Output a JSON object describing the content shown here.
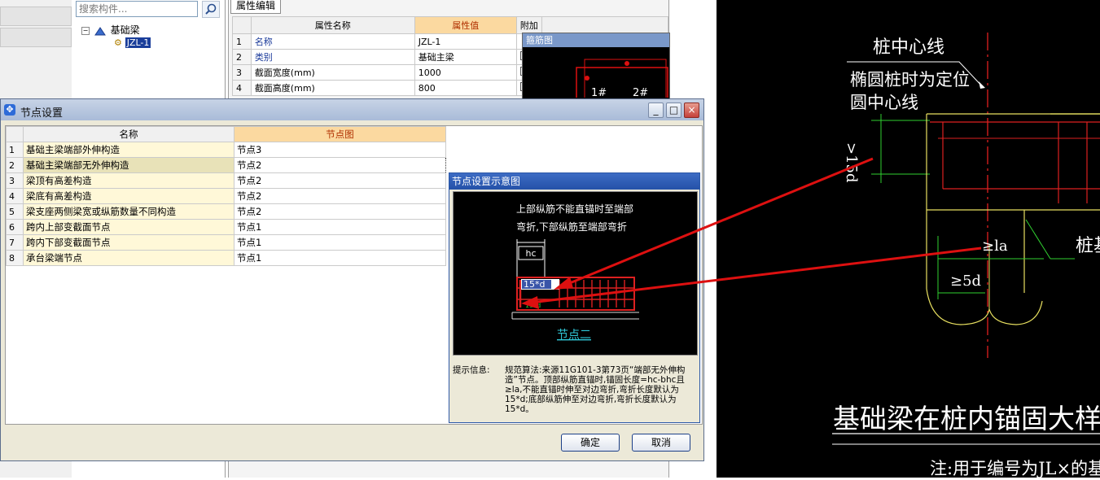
{
  "colors": {
    "accent_red": "#dd1010",
    "cad_bg": "#000000",
    "header_highlight": "#fbd9a0"
  },
  "left_tree": {
    "search_placeholder": "搜索构件...",
    "root_label": "基础梁",
    "child_label": "JZL-1"
  },
  "property_panel": {
    "tab": "属性编辑",
    "headers": {
      "name": "属性名称",
      "value": "属性值",
      "extra": "附加"
    },
    "rows": [
      {
        "idx": "1",
        "name": "名称",
        "value": "JZL-1"
      },
      {
        "idx": "2",
        "name": "类别",
        "value": "基础主梁"
      },
      {
        "idx": "3",
        "name": "截面宽度(mm)",
        "value": "1000"
      },
      {
        "idx": "4",
        "name": "截面高度(mm)",
        "value": "800"
      }
    ],
    "mini_preview_title": "箍筋图",
    "mini_labels": [
      "1#",
      "2#"
    ]
  },
  "cad_drawing": {
    "label_pile_center": "桩中心线",
    "label_ellipse_1": "椭圆桩时为定位",
    "label_ellipse_2": "圆中心线",
    "label_15d": ">15d",
    "label_la": "≥la",
    "label_5d": "≥5d",
    "label_pile_base": "桩基",
    "title": "基础梁在桩内锚固大样一",
    "note": "注:用于编号为JL×的基础梁"
  },
  "dialog": {
    "title": "节点设置",
    "minimize": "_",
    "maximize": "□",
    "close": "×",
    "headers": {
      "name": "名称",
      "diagram": "节点图"
    },
    "rows": [
      {
        "idx": "1",
        "name": "基础主梁端部外伸构造",
        "node": "节点3"
      },
      {
        "idx": "2",
        "name": "基础主梁端部无外伸构造",
        "node": "节点2"
      },
      {
        "idx": "3",
        "name": "梁顶有高差构造",
        "node": "节点2"
      },
      {
        "idx": "4",
        "name": "梁底有高差构造",
        "node": "节点2"
      },
      {
        "idx": "5",
        "name": "梁支座两侧梁宽或纵筋数量不同构造",
        "node": "节点2"
      },
      {
        "idx": "6",
        "name": "跨内上部变截面节点",
        "node": "节点1"
      },
      {
        "idx": "7",
        "name": "跨内下部变截面节点",
        "node": "节点1"
      },
      {
        "idx": "8",
        "name": "承台梁端节点",
        "node": "节点1"
      }
    ],
    "preview": {
      "title": "节点设置示意图",
      "line1": "上部纵筋不能直锚时至端部",
      "line2": "弯折,下部纵筋至端部弯折",
      "hc": "hc",
      "label_15d": "15*d",
      "label_bottom": "15*d",
      "node_link": "节点二"
    },
    "hint_label": "提示信息:",
    "hint_text": "规范算法:来源11G101-3第73页“端部无外伸构造”节点。顶部纵筋直锚时,锚固长度=hc-bhc且≥la,不能直锚时伸至对边弯折,弯折长度默认为15*d;底部纵筋伸至对边弯折,弯折长度默认为15*d。",
    "ok": "确定",
    "cancel": "取消"
  }
}
